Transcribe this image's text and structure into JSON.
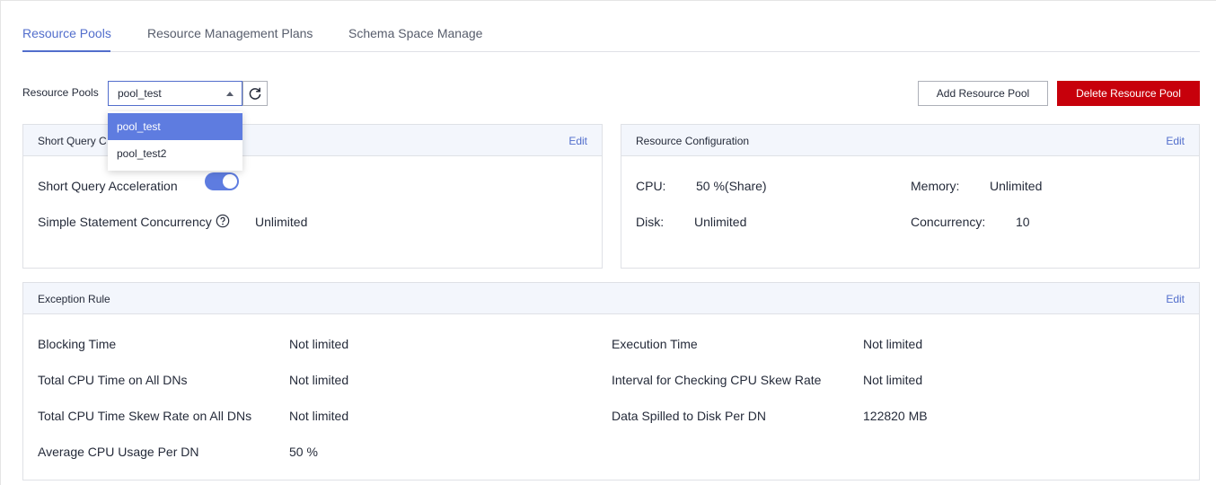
{
  "tabs": [
    {
      "label": "Resource Pools",
      "active": true
    },
    {
      "label": "Resource Management Plans",
      "active": false
    },
    {
      "label": "Schema Space Manage",
      "active": false
    }
  ],
  "toolbar": {
    "pool_label": "Resource Pools",
    "selected_pool": "pool_test",
    "refresh_icon": "refresh-icon",
    "add_button": "Add Resource Pool",
    "delete_button": "Delete Resource Pool"
  },
  "dropdown": {
    "options": [
      "pool_test",
      "pool_test2"
    ],
    "selected": "pool_test"
  },
  "short_query": {
    "title": "Short Query C",
    "edit": "Edit",
    "acceleration_label": "Short Query Acceleration",
    "acceleration_on": true,
    "concurrency_label": "Simple Statement Concurrency",
    "concurrency_value": "Unlimited"
  },
  "resource_config": {
    "title": "Resource Configuration",
    "edit": "Edit",
    "cpu_label": "CPU:",
    "cpu_value": "50 %(Share)",
    "memory_label": "Memory:",
    "memory_value": "Unlimited",
    "disk_label": "Disk:",
    "disk_value": "Unlimited",
    "concurrency_label": "Concurrency:",
    "concurrency_value": "10"
  },
  "exception_rule": {
    "title": "Exception Rule",
    "edit": "Edit",
    "left": [
      {
        "label": "Blocking Time",
        "value": "Not limited"
      },
      {
        "label": "Total CPU Time on All DNs",
        "value": "Not limited"
      },
      {
        "label": "Total CPU Time Skew Rate on All DNs",
        "value": "Not limited"
      },
      {
        "label": "Average CPU Usage Per DN",
        "value": "50 %"
      }
    ],
    "right": [
      {
        "label": "Execution Time",
        "value": "Not limited"
      },
      {
        "label": "Interval for Checking CPU Skew Rate",
        "value": "Not limited"
      },
      {
        "label": "Data Spilled to Disk Per DN",
        "value": "122820 MB"
      }
    ]
  },
  "colors": {
    "accent": "#526ecc",
    "danger": "#c7000b",
    "panel_header": "#f3f6fc"
  }
}
